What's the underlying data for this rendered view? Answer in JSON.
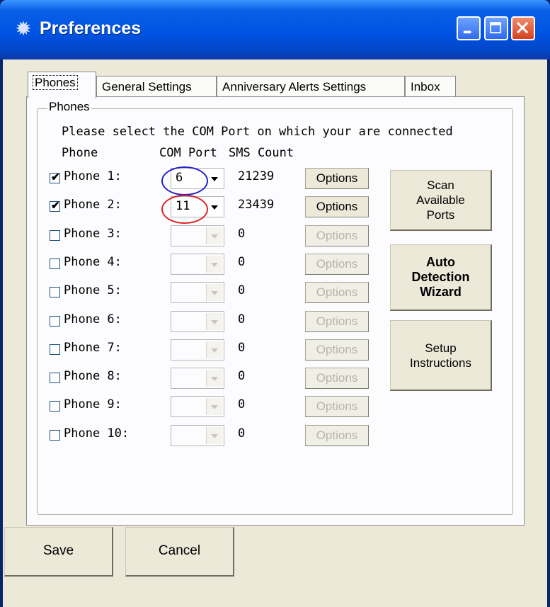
{
  "window": {
    "title": "Preferences"
  },
  "tabs": [
    {
      "label": "Phones",
      "active": true
    },
    {
      "label": "General Settings",
      "active": false
    },
    {
      "label": "Anniversary Alerts Settings",
      "active": false
    },
    {
      "label": "Inbox",
      "active": false
    }
  ],
  "group": {
    "title": "Phones",
    "instruction": "Please select the COM Port on which your are connected",
    "headers": {
      "phone": "Phone",
      "comport": "COM Port",
      "sms": "SMS Count"
    }
  },
  "phones": [
    {
      "label": "Phone 1:",
      "checked": true,
      "com": "6",
      "count": "21239",
      "options": "Options",
      "enabled": true
    },
    {
      "label": "Phone 2:",
      "checked": true,
      "com": "11",
      "count": "23439",
      "options": "Options",
      "enabled": true
    },
    {
      "label": "Phone 3:",
      "checked": false,
      "com": "",
      "count": "0",
      "options": "Options",
      "enabled": false
    },
    {
      "label": "Phone 4:",
      "checked": false,
      "com": "",
      "count": "0",
      "options": "Options",
      "enabled": false
    },
    {
      "label": "Phone 5:",
      "checked": false,
      "com": "",
      "count": "0",
      "options": "Options",
      "enabled": false
    },
    {
      "label": "Phone 6:",
      "checked": false,
      "com": "",
      "count": "0",
      "options": "Options",
      "enabled": false
    },
    {
      "label": "Phone 7:",
      "checked": false,
      "com": "",
      "count": "0",
      "options": "Options",
      "enabled": false
    },
    {
      "label": "Phone 8:",
      "checked": false,
      "com": "",
      "count": "0",
      "options": "Options",
      "enabled": false
    },
    {
      "label": "Phone 9:",
      "checked": false,
      "com": "",
      "count": "0",
      "options": "Options",
      "enabled": false
    },
    {
      "label": "Phone 10:",
      "checked": false,
      "com": "",
      "count": "0",
      "options": "Options",
      "enabled": false
    }
  ],
  "side_buttons": {
    "scan": "Scan\nAvailable\nPorts",
    "wizard": "Auto\nDetection\nWizard",
    "setup": "Setup\nInstructions"
  },
  "footer": {
    "save": "Save",
    "cancel": "Cancel"
  },
  "annotations": {
    "phone1_circle_color": "#2222cc",
    "phone2_circle_color": "#dd2222"
  },
  "icons": {
    "title": "gear-icon",
    "minimize": "minimize-icon",
    "maximize": "maximize-icon",
    "close": "close-icon",
    "dropdown": "chevron-down-icon",
    "check": "checkmark-icon"
  }
}
